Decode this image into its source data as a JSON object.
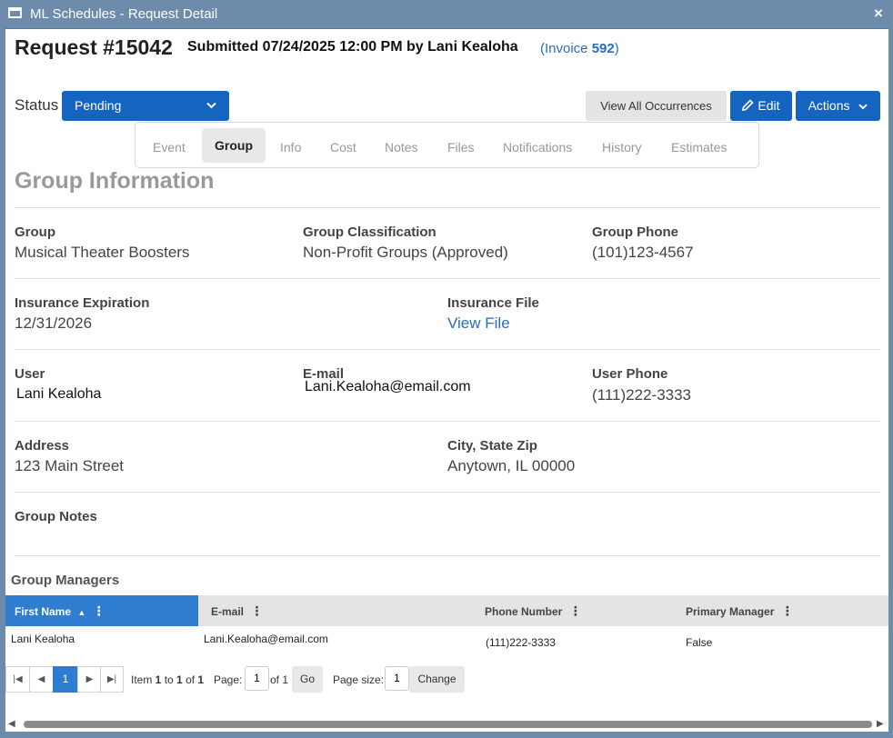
{
  "window": {
    "title": "ML Schedules - Request Detail",
    "close": "×"
  },
  "header": {
    "request": "Request #15042",
    "submitted": "Submitted 07/24/2025 12:00 PM by Lani Kealoha",
    "invoice_prefix": "(Invoice ",
    "invoice_number": "592",
    "invoice_suffix": ")"
  },
  "status": {
    "label": "Status",
    "value": "Pending"
  },
  "toolbar": {
    "view_all": "View All Occurrences",
    "edit": "Edit",
    "actions": "Actions"
  },
  "tabs": [
    "Event",
    "Group",
    "Info",
    "Cost",
    "Notes",
    "Files",
    "Notifications",
    "History",
    "Estimates"
  ],
  "active_tab": "Group",
  "section": {
    "title": "Group Information"
  },
  "fields": {
    "group": {
      "label": "Group",
      "value": "Musical Theater Boosters"
    },
    "classification": {
      "label": "Group Classification",
      "value": "Non-Profit Groups (Approved)"
    },
    "group_phone": {
      "label": "Group Phone",
      "value": "(101)123-4567"
    },
    "insurance_exp": {
      "label": "Insurance Expiration",
      "value": "12/31/2026"
    },
    "insurance_file": {
      "label": "Insurance File",
      "value": "View File"
    },
    "user": {
      "label": "User",
      "value": "Lani Kealoha"
    },
    "email": {
      "label": "E-mail",
      "value": "Lani.Kealoha@email.com"
    },
    "user_phone": {
      "label": "User Phone",
      "value": "(111)222-3333"
    },
    "address": {
      "label": "Address",
      "value": "123 Main Street"
    },
    "city": {
      "label": "City, State Zip",
      "value": "Anytown, IL 00000"
    },
    "notes": {
      "label": "Group Notes",
      "value": ""
    }
  },
  "managers": {
    "title": "Group Managers",
    "columns": [
      "First Name",
      "E-mail",
      "Phone Number",
      "Primary Manager"
    ],
    "rows": [
      {
        "first_name": "Lani Kealoha",
        "email": "Lani.Kealoha@email.com",
        "phone": "(111)222-3333",
        "primary": "False"
      }
    ]
  },
  "pager": {
    "current": "1",
    "item_prefix": "Item ",
    "item_from": "1",
    "item_to_word": " to ",
    "item_to": "1",
    "item_of_word": " of ",
    "item_total": "1",
    "page_label": "Page:",
    "page_value": "1",
    "of_pages": "of 1",
    "go": "Go",
    "size_label": "Page size:",
    "size_value": "1",
    "change": "Change"
  },
  "colors": {
    "titlebar": "#6d8bab",
    "primary": "#1565c0",
    "sorted_header": "#2e7dd1",
    "link": "#2a6ebb"
  }
}
